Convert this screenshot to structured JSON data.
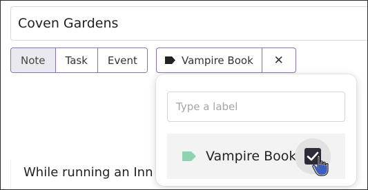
{
  "note": {
    "title": "Coven Gardens",
    "body_excerpt": "While running an Inn"
  },
  "type_tabs": [
    {
      "label": "Note",
      "active": true
    },
    {
      "label": "Task",
      "active": false
    },
    {
      "label": "Event",
      "active": false
    }
  ],
  "label_chip": {
    "label": "Vampire Book",
    "icon": "tag-icon",
    "remove_icon": "close-icon",
    "remove_glyph": "✕"
  },
  "label_popup": {
    "search_placeholder": "Type a label",
    "options": [
      {
        "label": "Vampire Book",
        "checked": true,
        "color": "#8fd4b0"
      }
    ]
  },
  "colors": {
    "accent_border": "#8a6fb8",
    "label_tag": "#8fd4b0",
    "checkbox": "#2c2c38",
    "cursor": "#3b5fc0"
  },
  "cursor": {
    "icon": "hand-pointer-icon"
  }
}
